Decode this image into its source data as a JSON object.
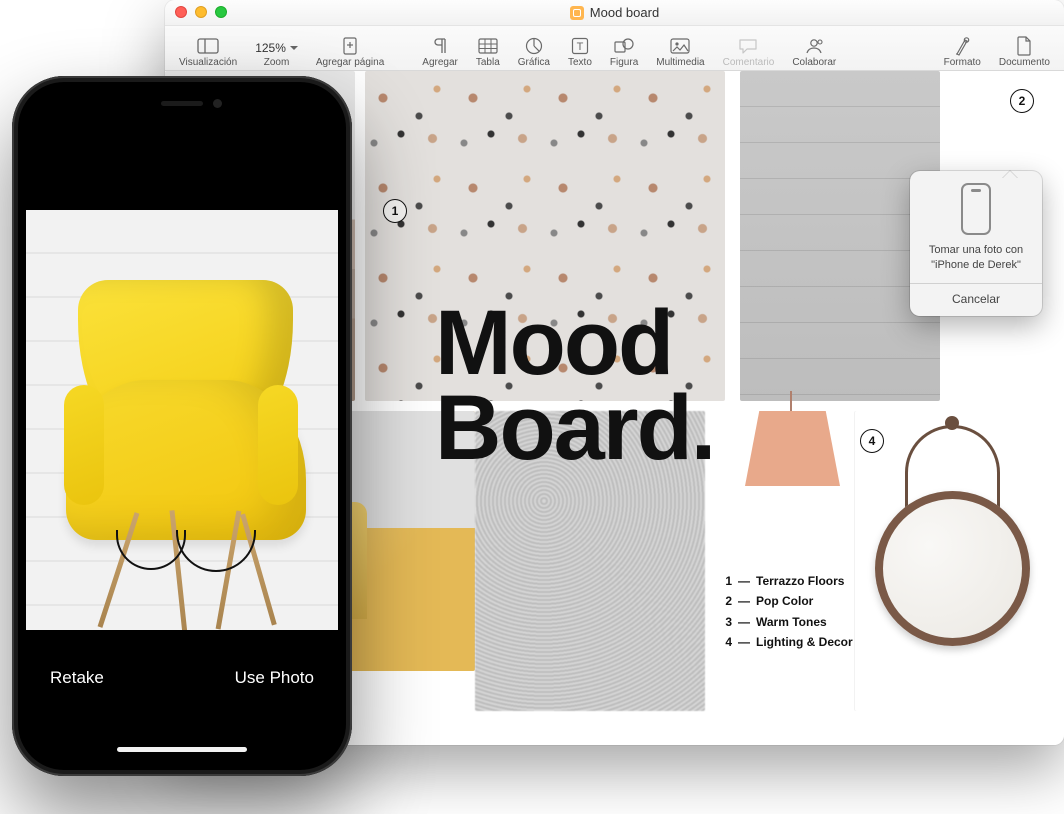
{
  "window": {
    "title": "Mood board"
  },
  "toolbar": {
    "visualizacion": "Visualización",
    "zoom_label": "Zoom",
    "zoom_value": "125%",
    "agregar_pagina": "Agregar página",
    "agregar": "Agregar",
    "tabla": "Tabla",
    "grafica": "Gráfica",
    "texto": "Texto",
    "figura": "Figura",
    "multimedia": "Multimedia",
    "comentario": "Comentario",
    "colaborar": "Colaborar",
    "formato": "Formato",
    "documento": "Documento"
  },
  "document": {
    "title": "Mood\nBoard.",
    "pins": {
      "p1": "1",
      "p2": "2",
      "p4": "4"
    },
    "legend": [
      {
        "n": "1",
        "label": "Terrazzo Floors"
      },
      {
        "n": "2",
        "label": "Pop Color"
      },
      {
        "n": "3",
        "label": "Warm Tones"
      },
      {
        "n": "4",
        "label": "Lighting & Decor"
      }
    ]
  },
  "popover": {
    "line1": "Tomar una foto con",
    "line2": "\"iPhone de Derek\"",
    "cancel": "Cancelar"
  },
  "iphone": {
    "retake": "Retake",
    "use_photo": "Use Photo"
  }
}
